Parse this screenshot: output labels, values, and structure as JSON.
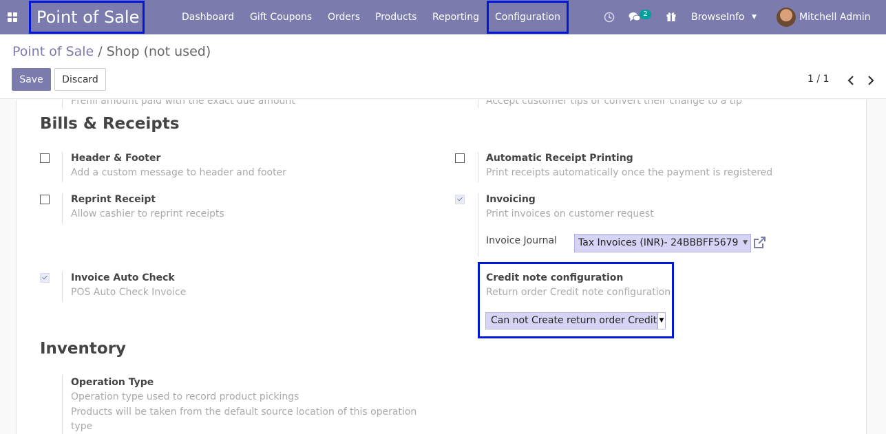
{
  "navbar": {
    "brand": "Point of Sale",
    "menu": [
      "Dashboard",
      "Gift Coupons",
      "Orders",
      "Products",
      "Reporting",
      "Configuration"
    ],
    "messages_badge": "2",
    "company": "BrowseInfo",
    "user": "Mitchell Admin",
    "bg_color": "#7c7bad",
    "highlight_color": "#0018d8"
  },
  "breadcrumb": {
    "parent": "Point of Sale",
    "separator": "/",
    "current": "Shop (not used)"
  },
  "buttons": {
    "save": "Save",
    "discard": "Discard"
  },
  "pager": {
    "value": "1 / 1"
  },
  "sheet": {
    "top_faded_left": "Prefill amount paid with the exact due amount",
    "top_faded_right": "Accept customer tips or convert their change to a tip",
    "bills_title": "Bills & Receipts",
    "header_footer": {
      "label": "Header & Footer",
      "help": "Add a custom message to header and footer",
      "checked": false
    },
    "auto_print": {
      "label": "Automatic Receipt Printing",
      "help": "Print receipts automatically once the payment is registered",
      "checked": false
    },
    "reprint": {
      "label": "Reprint Receipt",
      "help": "Allow cashier to reprint receipts",
      "checked": false
    },
    "invoicing": {
      "label": "Invoicing",
      "help": "Print invoices on customer request",
      "checked": true
    },
    "invoice_journal": {
      "label": "Invoice Journal",
      "value": "Tax Invoices (INR)- 24BBBFF5679"
    },
    "auto_check": {
      "label": "Invoice Auto Check",
      "help": "POS Auto Check Invoice",
      "checked": true
    },
    "credit_note": {
      "label": "Credit note configuration",
      "help": "Return order Credit note configuration",
      "value": "Can not Create return order Credit"
    },
    "inventory_title": "Inventory",
    "operation_type": {
      "label": "Operation Type",
      "help1": "Operation type used to record product pickings",
      "help2": "Products will be taken from the default source location of this operation",
      "help3": "type"
    }
  }
}
